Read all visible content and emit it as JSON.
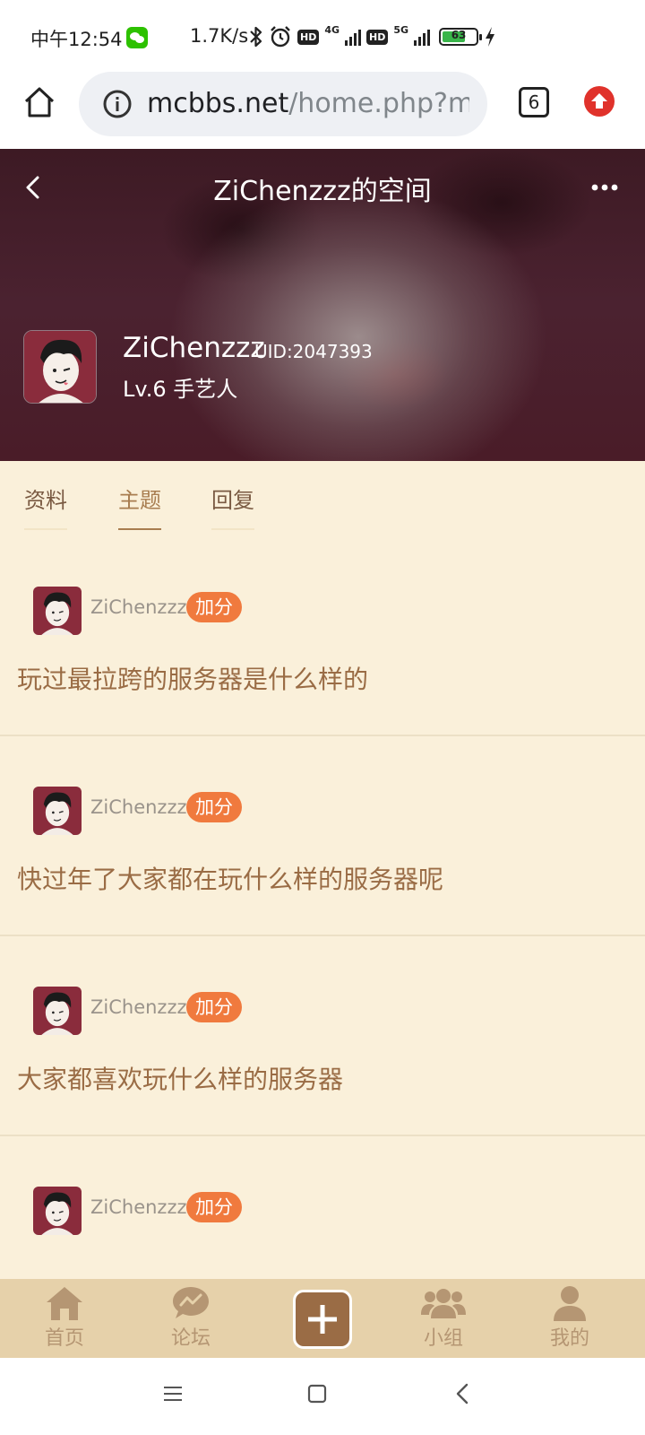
{
  "status_bar": {
    "time": "中午12:54",
    "speed": "1.7K/s",
    "net_4g": "4G",
    "net_5g": "5G",
    "hd": "HD",
    "battery": "63"
  },
  "browser": {
    "url_host": "mcbbs.net",
    "url_path": "/home.php?mod",
    "tab_count": "6"
  },
  "header": {
    "title": "ZiChenzzz的空间"
  },
  "profile": {
    "name": "ZiChenzzz",
    "uid": "UID:2047393",
    "level": "Lv.6 手艺人"
  },
  "tabs": [
    {
      "label": "资料",
      "active": false
    },
    {
      "label": "主题",
      "active": true
    },
    {
      "label": "回复",
      "active": false
    }
  ],
  "posts": [
    {
      "author": "ZiChenzzz",
      "badge": "加分",
      "title": "玩过最拉跨的服务器是什么样的"
    },
    {
      "author": "ZiChenzzz",
      "badge": "加分",
      "title": "快过年了大家都在玩什么样的服务器呢"
    },
    {
      "author": "ZiChenzzz",
      "badge": "加分",
      "title": "大家都喜欢玩什么样的服务器"
    },
    {
      "author": "ZiChenzzz",
      "badge": "加分",
      "title": ""
    }
  ],
  "bottom_nav": {
    "home": "首页",
    "forum": "论坛",
    "group": "小组",
    "mine": "我的"
  },
  "colors": {
    "content_bg": "#faf0da",
    "accent": "#a87d50",
    "badge": "#f07a3e",
    "nav_bg": "#e6d1aa",
    "nav_icon": "#b59673"
  }
}
